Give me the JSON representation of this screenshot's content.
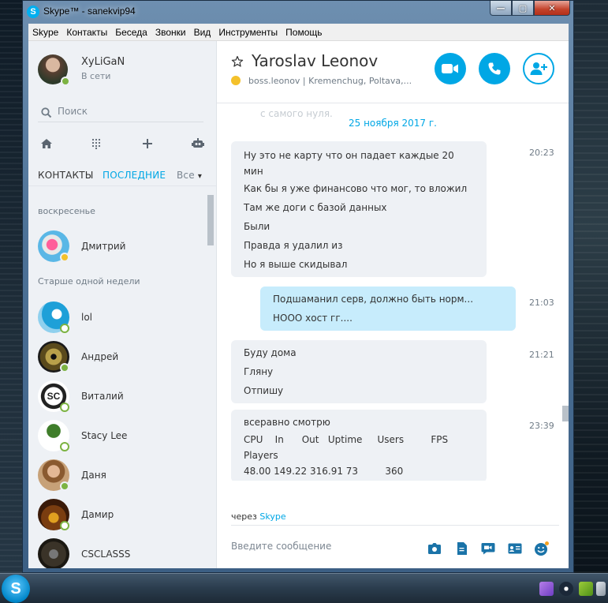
{
  "window": {
    "title": "Skype™ - sanekvip94",
    "min": "—",
    "max": "▢",
    "close": "✕"
  },
  "menu": [
    "Skype",
    "Контакты",
    "Беседа",
    "Звонки",
    "Вид",
    "Инструменты",
    "Помощь"
  ],
  "profile": {
    "name": "XyLiGaN",
    "status": "В сети"
  },
  "search": {
    "placeholder": "Поиск"
  },
  "tabs": {
    "contacts": "КОНТАКТЫ",
    "recent": "ПОСЛЕДНИЕ",
    "all": "Все"
  },
  "sections": {
    "sunday": "воскресенье",
    "older": "Старше одной недели"
  },
  "contacts": [
    {
      "name": "Дмитрий"
    },
    {
      "name": "lol"
    },
    {
      "name": "Андрей"
    },
    {
      "name": "Виталий"
    },
    {
      "name": "Stacy Lee"
    },
    {
      "name": "Даня"
    },
    {
      "name": "Дамир"
    },
    {
      "name": "CSCLASSS"
    }
  ],
  "chat": {
    "contact": "Yaroslav Leonov",
    "subtitle": "boss.leonov  |  Kremenchug, Poltava,...",
    "faded_text": "с самого нуля.",
    "date": "25 ноября 2017 г.",
    "messages": [
      {
        "time": "20:23",
        "lines": [
          "Ну это не карту что он падает каждые 20",
          "мин",
          "Как бы я уже финансово что мог, то вложил",
          "Там же доги с базой данных",
          "Были",
          "Правда я удалил из",
          "Но я выше скидывал"
        ]
      },
      {
        "time": "21:03",
        "lines": [
          "Подшаманил серв, должно быть норм...",
          "НООО хост гг...."
        ]
      },
      {
        "time": "21:21",
        "lines": [
          "Буду дома",
          "Гляну",
          "Отпишу"
        ]
      },
      {
        "time": "23:39",
        "lines": [
          "всеравно смотрю",
          "CPU    In      Out   Uptime     Users         FPS",
          "Players",
          "48.00 149.22 316.91 73         360"
        ]
      }
    ],
    "via_prefix": "через",
    "via_brand": "Skype",
    "compose_placeholder": "Введите сообщение"
  },
  "taskbar": {
    "start": "S"
  },
  "colors": {
    "accent": "#00a7e5",
    "online": "#7cb342",
    "away": "#f4c12b",
    "incoming": "#eef1f5",
    "outgoing": "#c7ecfc"
  }
}
